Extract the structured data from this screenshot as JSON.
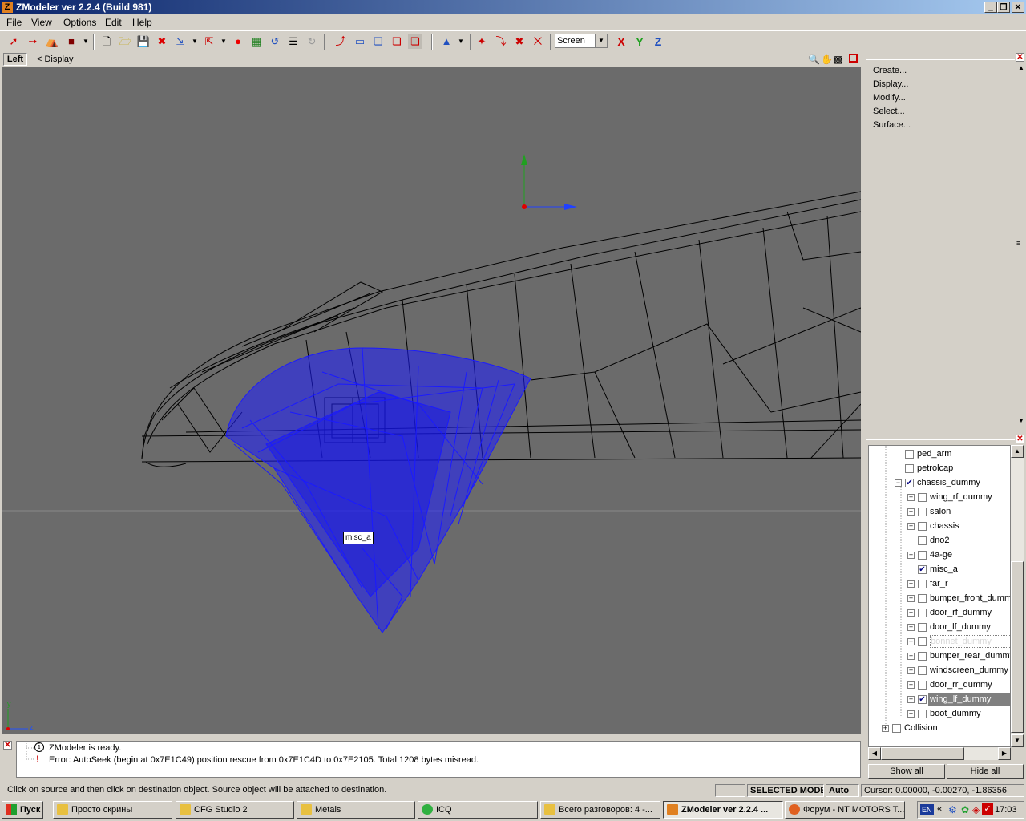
{
  "window": {
    "title": "ZModeler ver 2.2.4 (Build 981)",
    "app_icon": "Z"
  },
  "menu": {
    "file": "File",
    "view": "View",
    "options": "Options",
    "edit": "Edit",
    "help": "Help"
  },
  "toolbar": {
    "coord_system": "Screen",
    "axis_x": "X",
    "axis_y": "Y",
    "axis_z": "Z"
  },
  "viewport": {
    "name": "Left",
    "nav_label": "< Display",
    "object_tooltip": "misc_a",
    "axis_gizmo_x": "z",
    "axis_gizmo_y": "y"
  },
  "right_panel": {
    "menu": [
      "Create...",
      "Display...",
      "Modify...",
      "Select...",
      "Surface..."
    ]
  },
  "tree": {
    "items": [
      {
        "label": "ped_arm",
        "checked": false,
        "expander": false,
        "indent": 1
      },
      {
        "label": "petrolcap",
        "checked": false,
        "expander": false,
        "indent": 1
      },
      {
        "label": "chassis_dummy",
        "checked": true,
        "expander": "minus",
        "indent": 1
      },
      {
        "label": "wing_rf_dummy",
        "checked": false,
        "expander": "plus",
        "indent": 2
      },
      {
        "label": "salon",
        "checked": false,
        "expander": "plus",
        "indent": 2
      },
      {
        "label": "chassis",
        "checked": false,
        "expander": "plus",
        "indent": 2
      },
      {
        "label": "dno2",
        "checked": false,
        "expander": false,
        "indent": 2
      },
      {
        "label": "4a-ge",
        "checked": false,
        "expander": "plus",
        "indent": 2
      },
      {
        "label": "misc_a",
        "checked": true,
        "expander": false,
        "indent": 2
      },
      {
        "label": "far_r",
        "checked": false,
        "expander": "plus",
        "indent": 2
      },
      {
        "label": "bumper_front_dummy",
        "checked": false,
        "expander": "plus",
        "indent": 2
      },
      {
        "label": "door_rf_dummy",
        "checked": false,
        "expander": "plus",
        "indent": 2
      },
      {
        "label": "door_lf_dummy",
        "checked": false,
        "expander": "plus",
        "indent": 2
      },
      {
        "label": "bonnet_dummy",
        "checked": false,
        "expander": "plus",
        "indent": 2,
        "state": "dimmed"
      },
      {
        "label": "bumper_rear_dummy",
        "checked": false,
        "expander": "plus",
        "indent": 2
      },
      {
        "label": "windscreen_dummy",
        "checked": false,
        "expander": "plus",
        "indent": 2
      },
      {
        "label": "door_rr_dummy",
        "checked": false,
        "expander": "plus",
        "indent": 2
      },
      {
        "label": "wing_lf_dummy",
        "checked": true,
        "expander": "plus",
        "indent": 2,
        "state": "selected"
      },
      {
        "label": "boot_dummy",
        "checked": false,
        "expander": "plus",
        "indent": 2
      },
      {
        "label": "Collision",
        "checked": false,
        "expander": "plus",
        "indent": 0
      }
    ],
    "show_all": "Show all",
    "hide_all": "Hide all"
  },
  "log": {
    "lines": [
      {
        "icon": "info-icon",
        "text": "ZModeler is ready."
      },
      {
        "icon": "error-icon",
        "text": "Error: AutoSeek (begin at 0x7E1C49) position rescue  from 0x7E1C4D to 0x7E2105. Total 1208 bytes misread."
      }
    ]
  },
  "status": {
    "hint": "Click on source and then click on destination object. Source object will be attached to destination.",
    "mode": "SELECTED MODE",
    "auto": "Auto",
    "cursor": "Cursor: 0.00000, -0.00270, -1.86356"
  },
  "taskbar": {
    "start": "Пуск",
    "tasks": [
      {
        "label": "Просто скрины",
        "icon": "folder"
      },
      {
        "label": "CFG Studio 2",
        "icon": "folder"
      },
      {
        "label": "Metals",
        "icon": "folder"
      },
      {
        "label": "ICQ",
        "icon": "icq"
      },
      {
        "label": "Всего разговоров: 4 -...",
        "icon": "chat"
      },
      {
        "label": "ZModeler ver 2.2.4 ...",
        "icon": "zmodeler",
        "active": true
      },
      {
        "label": "Форум - NT MOTORS T...",
        "icon": "firefox"
      }
    ],
    "lang": "EN",
    "clock": "17:03"
  },
  "colors": {
    "viewport_bg": "#6b6b6b",
    "selection": "#1a1aff",
    "wire": "#000000",
    "title_start": "#0a246a",
    "title_end": "#a6caf0"
  }
}
